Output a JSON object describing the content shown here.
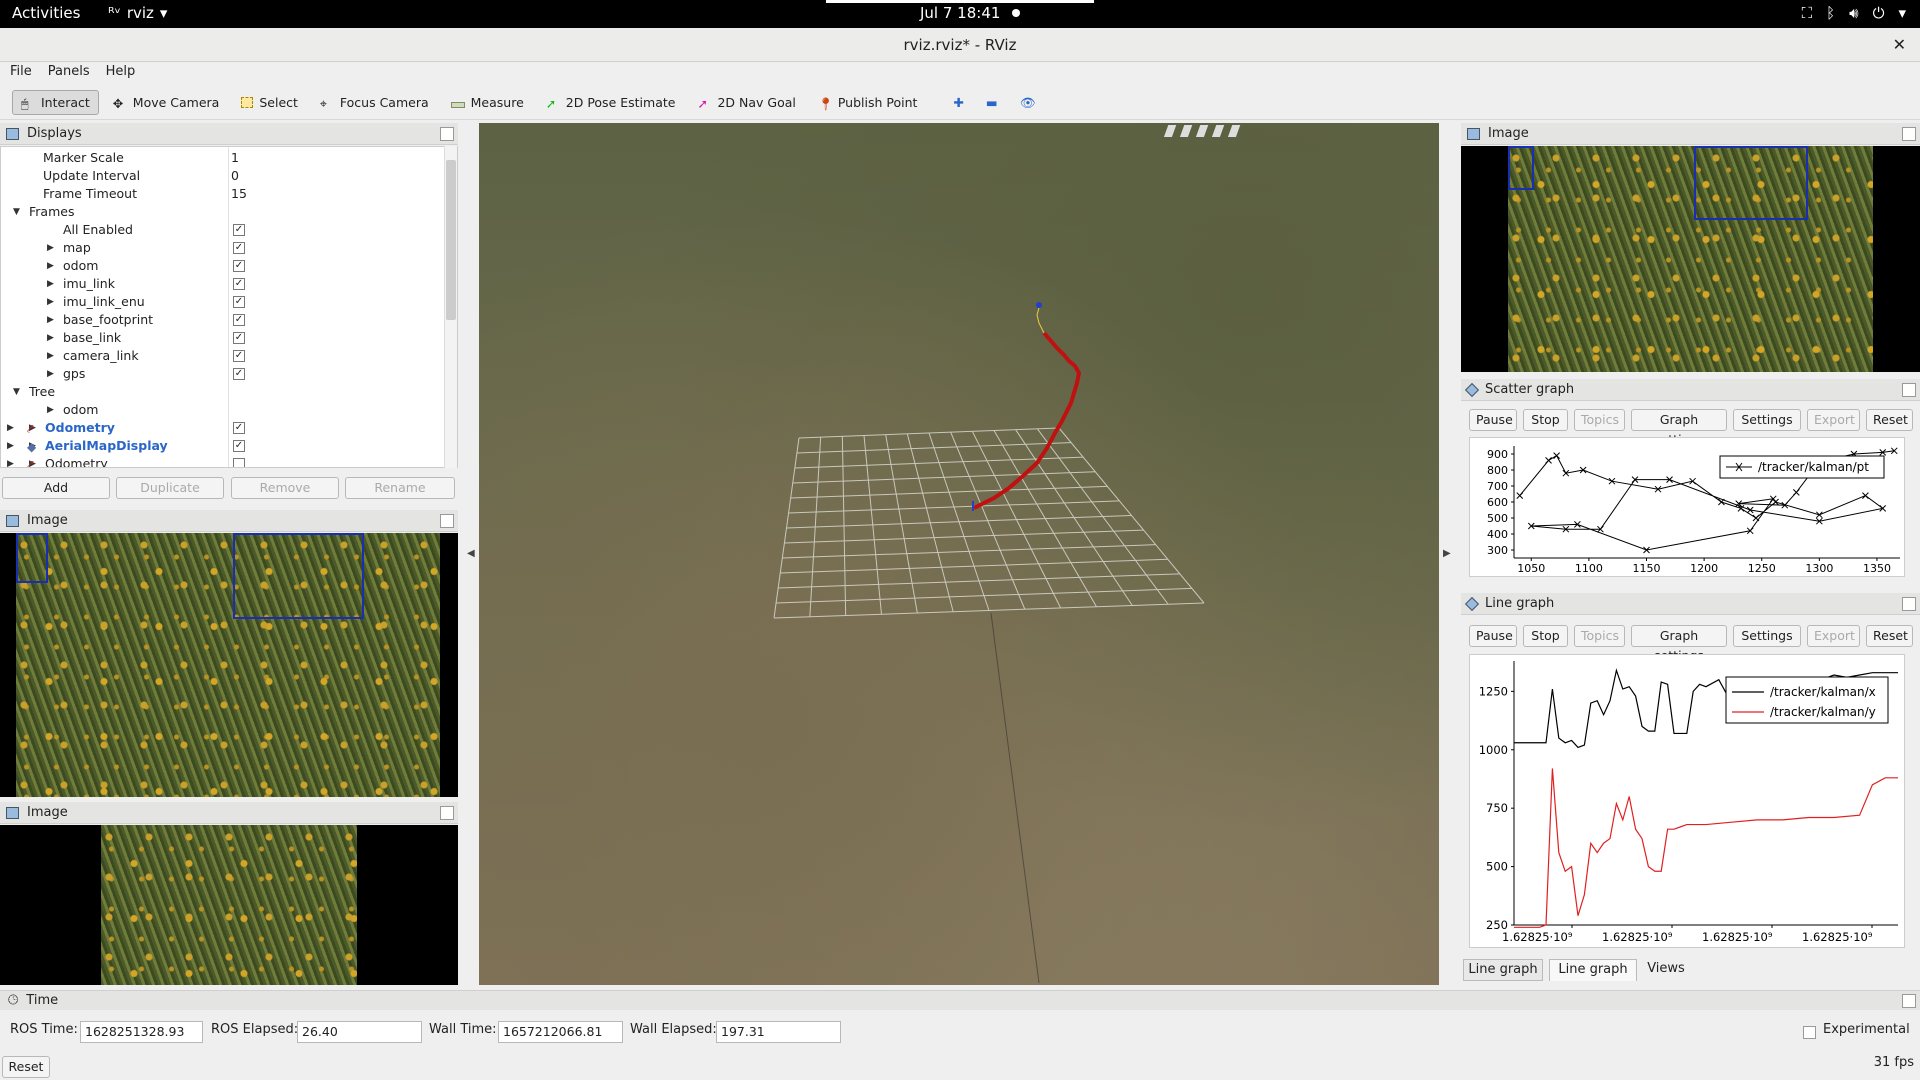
{
  "topbar": {
    "activities": "Activities",
    "app_name": "rviz",
    "clock": "Jul 7  18:41"
  },
  "window": {
    "title": "rviz.rviz* - RViz"
  },
  "menu": [
    "File",
    "Panels",
    "Help"
  ],
  "toolbar": [
    {
      "label": "Interact",
      "icon": "cursor-icon",
      "active": true
    },
    {
      "label": "Move Camera",
      "icon": "move-camera-icon"
    },
    {
      "label": "Select",
      "icon": "select-icon"
    },
    {
      "label": "Focus Camera",
      "icon": "focus-camera-icon"
    },
    {
      "label": "Measure",
      "icon": "ruler-icon"
    },
    {
      "label": "2D Pose Estimate",
      "icon": "green-arrow-icon"
    },
    {
      "label": "2D Nav Goal",
      "icon": "pink-arrow-icon"
    },
    {
      "label": "Publish Point",
      "icon": "pin-icon"
    }
  ],
  "displays": {
    "title": "Displays",
    "rows": [
      {
        "name": "Marker Scale",
        "value": "1"
      },
      {
        "name": "Update Interval",
        "value": "0"
      },
      {
        "name": "Frame Timeout",
        "value": "15"
      },
      {
        "name": "Frames",
        "expanded": true
      },
      {
        "name": "All Enabled",
        "checked": true
      },
      {
        "name": "map",
        "checked": true
      },
      {
        "name": "odom",
        "checked": true
      },
      {
        "name": "imu_link",
        "checked": true
      },
      {
        "name": "imu_link_enu",
        "checked": true
      },
      {
        "name": "base_footprint",
        "checked": true
      },
      {
        "name": "base_link",
        "checked": true
      },
      {
        "name": "camera_link",
        "checked": true
      },
      {
        "name": "gps",
        "checked": true
      },
      {
        "name": "Tree",
        "expanded": true
      },
      {
        "name": "odom"
      },
      {
        "name": "Odometry",
        "checked": true,
        "blue": true
      },
      {
        "name": "AerialMapDisplay",
        "checked": true,
        "blue": true
      },
      {
        "name": "Odometry",
        "checked": false
      }
    ],
    "buttons": {
      "add": "Add",
      "duplicate": "Duplicate",
      "remove": "Remove",
      "rename": "Rename"
    }
  },
  "image_panels": {
    "left_top": "Image",
    "left_bottom": "Image",
    "right": "Image"
  },
  "scatter": {
    "title": "Scatter graph",
    "buttons": [
      "Pause",
      "Stop",
      "Topics",
      "Graph settings",
      "Settings",
      "Export",
      "Reset"
    ],
    "legend": "/tracker/kalman/pt",
    "chart_data": {
      "type": "scatter",
      "xlim": [
        1035,
        1370
      ],
      "ylim": [
        250,
        950
      ],
      "xticks": [
        "1050",
        "1100",
        "1150",
        "1200",
        "1250",
        "1300",
        "1350"
      ],
      "yticks": [
        "300",
        "400",
        "500",
        "600",
        "700",
        "800",
        "900"
      ],
      "series": [
        {
          "name": "/tracker/kalman/pt",
          "x": [
            1040,
            1065,
            1072,
            1080,
            1095,
            1120,
            1160,
            1190,
            1215,
            1232,
            1245,
            1262,
            1300,
            1340,
            1355,
            1300,
            1240,
            1170,
            1140,
            1110,
            1080,
            1050,
            1090,
            1150,
            1240,
            1260,
            1230,
            1270,
            1280,
            1300,
            1330,
            1355,
            1365
          ],
          "y": [
            640,
            860,
            890,
            780,
            800,
            730,
            680,
            730,
            600,
            560,
            500,
            600,
            520,
            640,
            560,
            480,
            550,
            740,
            740,
            430,
            430,
            450,
            460,
            300,
            420,
            620,
            590,
            580,
            660,
            850,
            900,
            910,
            920
          ]
        }
      ]
    }
  },
  "linegraph": {
    "title": "Line graph",
    "buttons": [
      "Pause",
      "Stop",
      "Topics",
      "Graph settings",
      "Settings",
      "Export",
      "Reset"
    ],
    "legend": [
      "/tracker/kalman/x",
      "/tracker/kalman/y"
    ],
    "chart_data": {
      "type": "line",
      "ylim": [
        250,
        1380
      ],
      "yticks": [
        "250",
        "500",
        "750",
        "1000",
        "1250"
      ],
      "xticks": [
        "1.62825·10⁹",
        "1.62825·10⁹",
        "1.62825·10⁹",
        "1.62825·10⁹"
      ],
      "series": [
        {
          "name": "/tracker/kalman/x",
          "color": "#000000",
          "x": [
            0,
            4,
            5,
            6,
            7,
            8,
            9,
            10,
            11,
            12,
            13,
            14,
            15,
            16,
            17,
            18,
            19,
            20,
            21,
            22,
            23,
            24,
            25,
            26,
            27,
            28,
            29,
            30,
            32,
            34,
            36,
            38,
            40,
            42,
            44,
            46,
            48,
            50,
            52,
            54,
            56,
            58,
            60
          ],
          "y": [
            1030,
            1030,
            1030,
            1260,
            1050,
            1030,
            1040,
            1010,
            1020,
            1200,
            1210,
            1150,
            1210,
            1340,
            1260,
            1270,
            1230,
            1100,
            1080,
            1080,
            1290,
            1280,
            1070,
            1070,
            1070,
            1250,
            1280,
            1270,
            1300,
            1200,
            1250,
            1280,
            1270,
            1300,
            1290,
            1310,
            1300,
            1320,
            1310,
            1320,
            1330,
            1330,
            1330
          ]
        },
        {
          "name": "/tracker/kalman/y",
          "color": "#e02020",
          "x": [
            0,
            4,
            5,
            6,
            7,
            8,
            9,
            10,
            11,
            12,
            13,
            14,
            15,
            16,
            17,
            18,
            19,
            20,
            21,
            22,
            23,
            24,
            25,
            26,
            27,
            28,
            30,
            34,
            38,
            42,
            46,
            50,
            54,
            56,
            58,
            60
          ],
          "y": [
            240,
            240,
            250,
            920,
            560,
            480,
            500,
            290,
            380,
            600,
            560,
            600,
            620,
            770,
            700,
            800,
            660,
            620,
            500,
            480,
            480,
            660,
            660,
            670,
            680,
            680,
            680,
            690,
            700,
            700,
            710,
            710,
            720,
            850,
            880,
            880
          ]
        }
      ]
    }
  },
  "right_tabs": [
    "Line graph",
    "Line graph",
    "Views"
  ],
  "time": {
    "title": "Time",
    "ros_time_label": "ROS Time:",
    "ros_time": "1628251328.93",
    "ros_elapsed_label": "ROS Elapsed:",
    "ros_elapsed": "26.40",
    "wall_time_label": "Wall Time:",
    "wall_time": "1657212066.81",
    "wall_elapsed_label": "Wall Elapsed:",
    "wall_elapsed": "197.31",
    "experimental": "Experimental",
    "reset": "Reset",
    "fps": "31 fps"
  },
  "colors": {
    "accent_blue": "#2a66c8",
    "bbox": "#1a2fb0",
    "path_red": "#c01010"
  }
}
